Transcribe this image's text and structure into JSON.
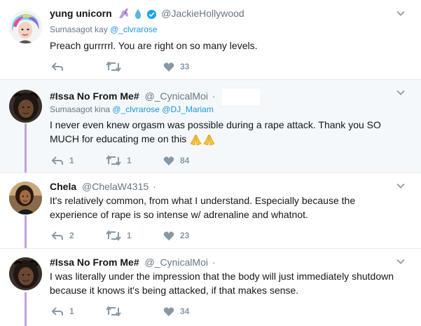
{
  "tweets": [
    {
      "name": "yung unicorn",
      "handle": "@JackieHollywood",
      "dot": "",
      "replying_prefix": "Sumasagot kay",
      "mentions": [
        "@_clvrarose"
      ],
      "text": "Preach gurrrrrl. You are right on so many levels.",
      "reply_count": "",
      "retweet_count": "",
      "like_count": "33"
    },
    {
      "name": "#Issa No From Me#",
      "handle": "@_CynicalMoi",
      "dot": "·",
      "replying_prefix": "Sumasagot kina",
      "mentions": [
        "@_clvrarose",
        "@DJ_Mariam"
      ],
      "text_line1": "I never even knew orgasm was possible during a rape attack. Thank you SO",
      "text_line2": "MUCH for educating me on this",
      "reply_count": "1",
      "retweet_count": "1",
      "like_count": "84"
    },
    {
      "name": "Chela",
      "handle": "@ChelaW4315",
      "dot": "·",
      "text_line1": "It's relatively common, from what I understand. Especially because the",
      "text_line2": "experience of rape is so intense w/ adrenaline and whatnot.",
      "reply_count": "2",
      "retweet_count": "1",
      "like_count": "23"
    },
    {
      "name": "#Issa No From Me#",
      "handle": "@_CynicalMoi",
      "dot": "·",
      "text_line1": "I was literally under the impression that the body will just immediately shutdown",
      "text_line2": "because it knows it's being attacked, if that makes sense.",
      "reply_count": "1",
      "retweet_count": "",
      "like_count": "34"
    }
  ],
  "colors": {
    "action_gray": "#8899a6",
    "link_blue": "#1b95e0",
    "thread_line": "#c4a0e0",
    "highlight_bg": "#f5f8fa"
  },
  "icons": [
    "reply-icon",
    "retweet-icon",
    "heart-icon",
    "chevron-down-icon",
    "verified-badge-icon",
    "unicorn-emoji-icon",
    "droplet-emoji-icon",
    "praying-hands-emoji-icon"
  ]
}
